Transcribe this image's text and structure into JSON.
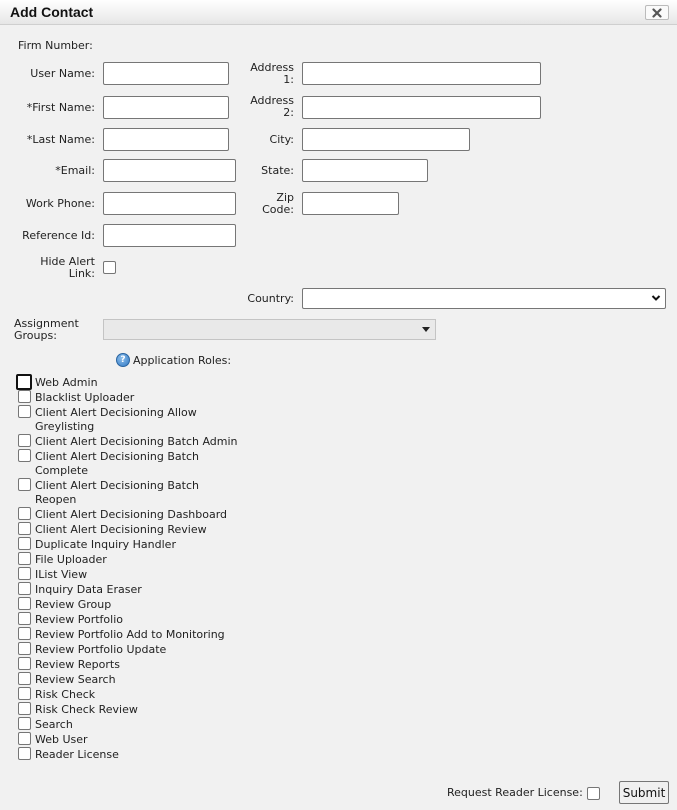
{
  "dialog": {
    "title": "Add Contact",
    "close_icon": "close-x-icon"
  },
  "form": {
    "firm_number_label": "Firm Number:",
    "firm_number_value": "",
    "user_name": {
      "label": "User Name:",
      "value": ""
    },
    "first_name": {
      "label": "*First Name:",
      "value": ""
    },
    "last_name": {
      "label": "*Last Name:",
      "value": ""
    },
    "email": {
      "label": "*Email:",
      "value": ""
    },
    "work_phone": {
      "label": "Work Phone:",
      "value": ""
    },
    "reference_id": {
      "label": "Reference Id:",
      "value": ""
    },
    "hide_alert_link": {
      "label_line1": "Hide Alert",
      "label_line2": "Link:",
      "checked": false
    },
    "address1": {
      "label_line1": "Address",
      "label_line2": "1:",
      "value": ""
    },
    "address2": {
      "label_line1": "Address",
      "label_line2": "2:",
      "value": ""
    },
    "city": {
      "label": "City:",
      "value": ""
    },
    "state": {
      "label": "State:",
      "value": ""
    },
    "zip": {
      "label_line1": "Zip",
      "label_line2": "Code:",
      "value": ""
    },
    "country": {
      "label": "Country:",
      "selected": ""
    },
    "assignment_groups": {
      "label_line1": "Assignment",
      "label_line2": "Groups:",
      "selected": ""
    }
  },
  "roles": {
    "heading": "Application Roles:",
    "help_icon": "help-question-icon",
    "items": [
      {
        "label": "Web Admin",
        "checked": false,
        "focused": true
      },
      {
        "label": "Blacklist Uploader",
        "checked": false
      },
      {
        "label": "Client Alert Decisioning Allow Greylisting",
        "checked": false
      },
      {
        "label": "Client Alert Decisioning Batch Admin",
        "checked": false
      },
      {
        "label": "Client Alert Decisioning Batch Complete",
        "checked": false
      },
      {
        "label": "Client Alert Decisioning Batch Reopen",
        "checked": false
      },
      {
        "label": "Client Alert Decisioning Dashboard",
        "checked": false
      },
      {
        "label": "Client Alert Decisioning Review",
        "checked": false
      },
      {
        "label": "Duplicate Inquiry Handler",
        "checked": false
      },
      {
        "label": "File Uploader",
        "checked": false
      },
      {
        "label": "IList View",
        "checked": false
      },
      {
        "label": "Inquiry Data Eraser",
        "checked": false
      },
      {
        "label": "Review Group",
        "checked": false
      },
      {
        "label": "Review Portfolio",
        "checked": false
      },
      {
        "label": "Review Portfolio Add to Monitoring",
        "checked": false
      },
      {
        "label": "Review Portfolio Update",
        "checked": false
      },
      {
        "label": "Review Reports",
        "checked": false
      },
      {
        "label": "Review Search",
        "checked": false
      },
      {
        "label": "Risk Check",
        "checked": false
      },
      {
        "label": "Risk Check Review",
        "checked": false
      },
      {
        "label": "Search",
        "checked": false
      },
      {
        "label": "Web User",
        "checked": false
      },
      {
        "label": "Reader License",
        "checked": false
      }
    ]
  },
  "footer": {
    "request_reader_license_label": "Request Reader License:",
    "request_reader_license_checked": false,
    "submit_label": "Submit"
  }
}
